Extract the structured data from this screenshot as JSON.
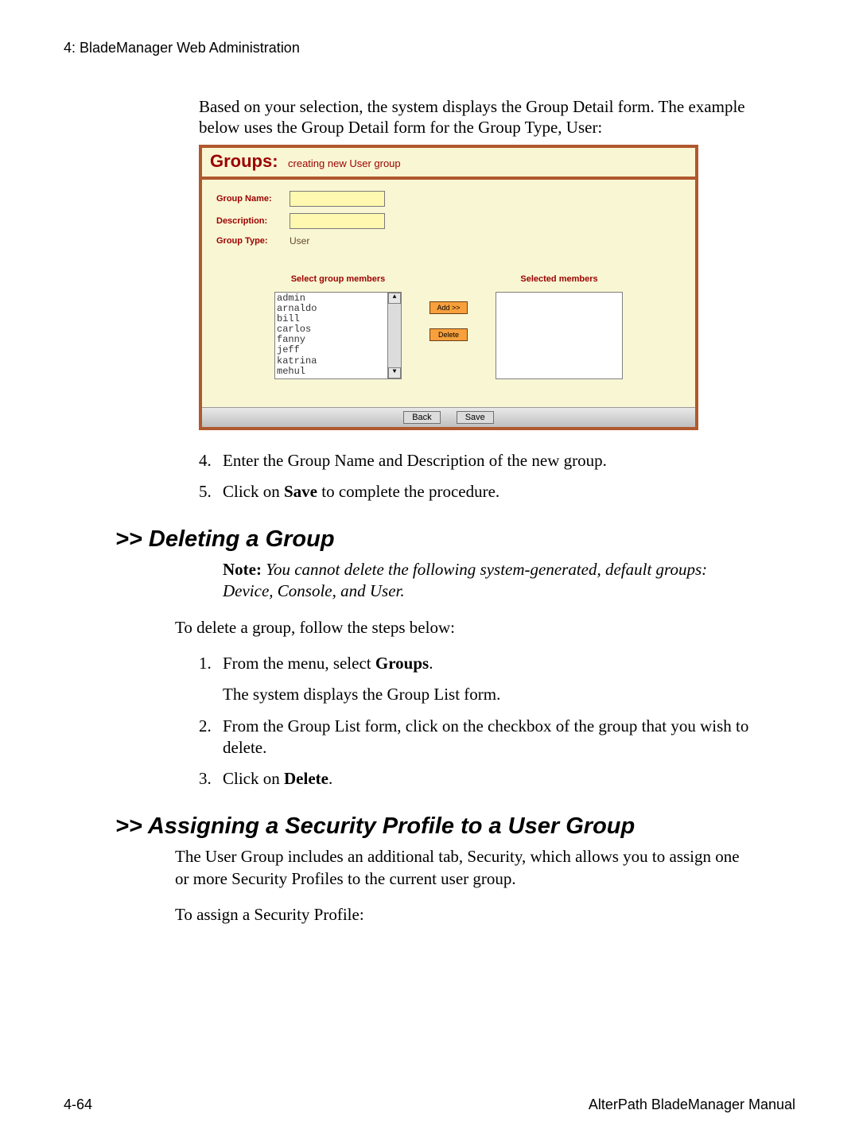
{
  "chapter_header": "4: BladeManager Web Administration",
  "intro": "Based on your selection, the system displays the Group Detail form. The example below uses the Group Detail form for the Group Type, User:",
  "shot": {
    "title": "Groups:",
    "subtitle": "creating new User group",
    "labels": {
      "group_name": "Group Name:",
      "description": "Description:",
      "group_type": "Group Type:"
    },
    "group_type_value": "User",
    "select_members_title": "Select group members",
    "selected_members_title": "Selected members",
    "members": [
      "admin",
      "arnaldo",
      "bill",
      "carlos",
      "fanny",
      "jeff",
      "katrina",
      "mehul"
    ],
    "add_btn": "Add >>",
    "delete_btn": "Delete",
    "back_btn": "Back",
    "save_btn": "Save"
  },
  "list_a": [
    {
      "n": "4.",
      "t_before": "Enter the Group Name and Description of the new group."
    },
    {
      "n": "5.",
      "t_before": "Click on ",
      "t_bold": "Save",
      "t_after": " to complete the procedure."
    }
  ],
  "h_delete": ">> Deleting a Group",
  "note": {
    "label": "Note:",
    "text": " You cannot delete the following system-generated, default groups: Device, Console, and User."
  },
  "delete_intro": "To delete a group, follow the steps below:",
  "list_b_item1": {
    "n": "1.",
    "before": "From the menu, select ",
    "bold": "Groups",
    "after": ".",
    "sub": "The system displays the Group List form."
  },
  "list_b_item2": {
    "n": "2.",
    "text": "From the Group List form, click on the checkbox of the group that you wish to delete."
  },
  "list_b_item3": {
    "n": "3.",
    "before": "Click on ",
    "bold": "Delete",
    "after": "."
  },
  "h_assign": ">> Assigning a Security Profile to a User Group",
  "assign_p1": "The User Group includes an additional tab, Security, which allows you to assign one or more Security Profiles to the current user group.",
  "assign_p2": "To assign a Security Profile:",
  "page_num": "4-64",
  "manual_title": "AlterPath BladeManager Manual"
}
